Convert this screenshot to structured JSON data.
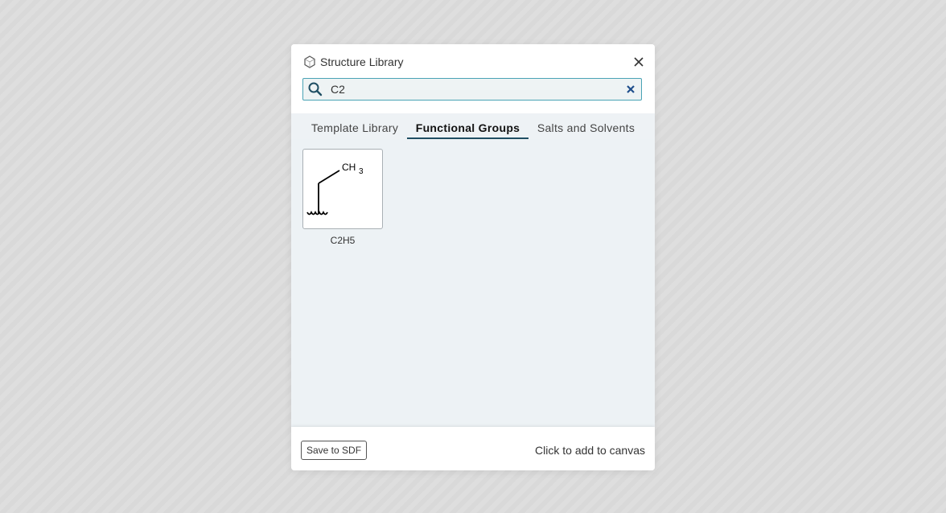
{
  "dialog": {
    "title": "Structure Library",
    "close_label": "×"
  },
  "search": {
    "value": "C2",
    "placeholder": ""
  },
  "tabs": [
    {
      "label": "Template Library",
      "active": false
    },
    {
      "label": "Functional Groups",
      "active": true
    },
    {
      "label": "Salts and Solvents",
      "active": false
    }
  ],
  "results": [
    {
      "name": "C2H5",
      "structure_text": "CH",
      "subscript": "3"
    }
  ],
  "footer": {
    "save_label": "Save to SDF",
    "hint": "Click to add to canvas"
  },
  "colors": {
    "accent": "#4aa3b5",
    "tab_underline": "#1f4e63",
    "content_bg": "#edf2f5",
    "clear_icon": "#1f4e8c"
  }
}
